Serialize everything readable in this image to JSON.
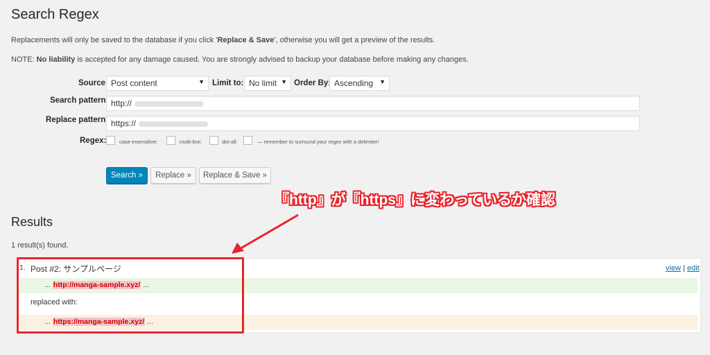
{
  "page": {
    "title": "Search Regex",
    "info_prefix": "Replacements will only be saved to the database if you click '",
    "info_bold": "Replace & Save",
    "info_suffix": "', otherwise you will get a preview of the results.",
    "note_prefix": "NOTE: ",
    "note_bold": "No liability",
    "note_suffix": " is accepted for any damage caused. You are strongly advised to backup your database before making any changes."
  },
  "form": {
    "source_label": "Source",
    "source_value": "Post content",
    "limit_label": "Limit to:",
    "limit_value": "No limit",
    "orderby_label": "Order By:",
    "orderby_value": "Ascending",
    "search_label": "Search pattern",
    "search_value": "http://",
    "replace_label": "Replace pattern",
    "replace_value": "https://",
    "regex_label": "Regex:",
    "case_label": "case-insensitive:",
    "multiline_label": "multi-line:",
    "dotall_label": "dot-all:",
    "hint": "— remember to surround your regex with a delimiter!"
  },
  "buttons": {
    "search": "Search »",
    "replace": "Replace »",
    "replace_save": "Replace & Save »"
  },
  "results": {
    "title": "Results",
    "count": "1 result(s) found.",
    "items": [
      {
        "number": "1.",
        "post": "Post #2: サンプルページ",
        "view": "view",
        "sep": "|",
        "edit": "edit",
        "ellipsis": "...",
        "search_match": "http://manga-sample.xyz/",
        "replaced_with": "replaced with:",
        "replace_match": "https://manga-sample.xyz/"
      }
    ]
  },
  "annotation": {
    "text": "『http』が『https』に変わっているか確認",
    "color": "#e8232b"
  },
  "colors": {
    "primary_button": "#0085ba",
    "search_row": "#eaf7e3",
    "replace_row": "#fbf1e3",
    "match_text": "#cc0000"
  }
}
